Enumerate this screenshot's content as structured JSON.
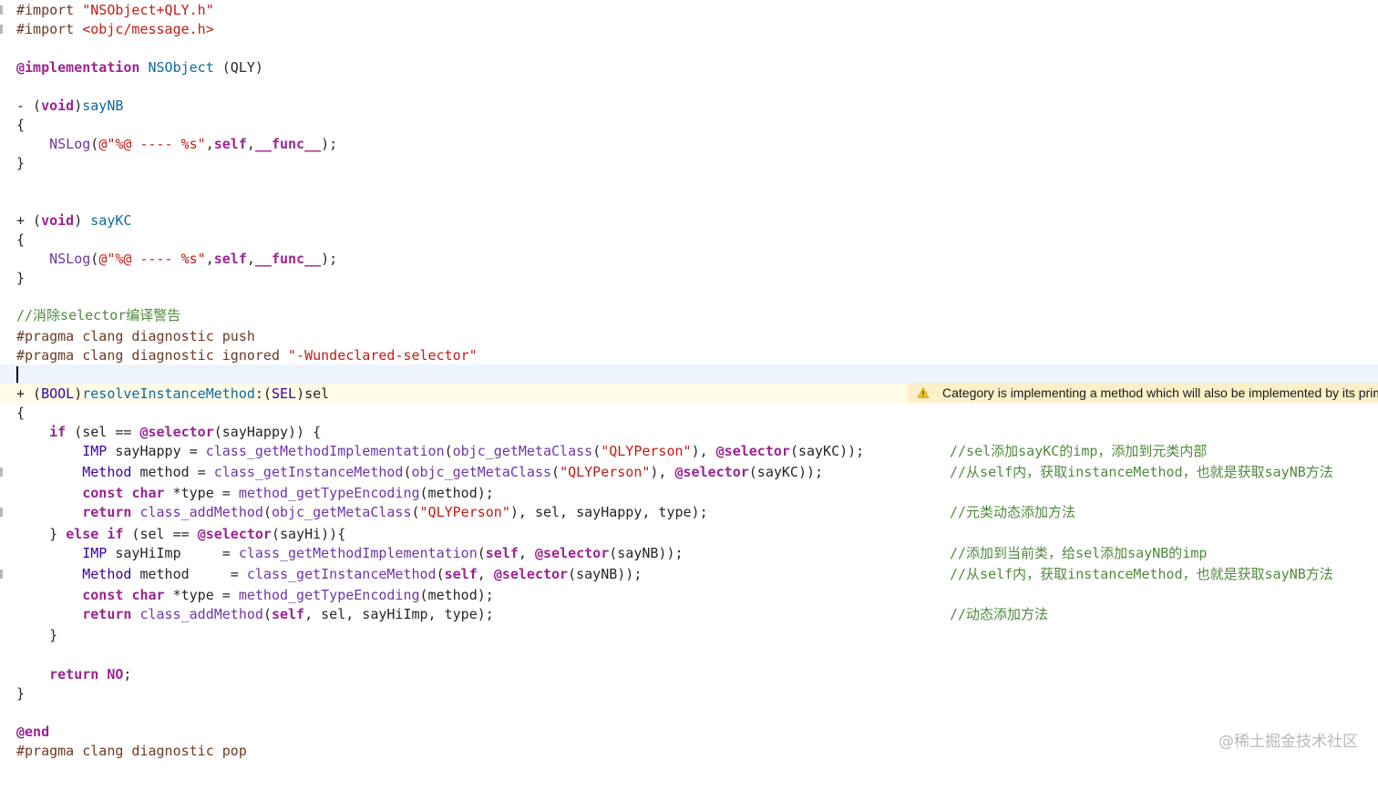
{
  "editor": {
    "lines": {
      "l1": {
        "a": "#import ",
        "b": "\"NSObject+QLY.h\""
      },
      "l2": {
        "a": "#import ",
        "b": "<objc/message.h>"
      },
      "l4": {
        "a": "@implementation",
        "b": " ",
        "c": "NSObject",
        "d": " (QLY)"
      },
      "l6": {
        "a": "- (",
        "b": "void",
        "c": ")",
        "d": "sayNB"
      },
      "l7": {
        "a": "{"
      },
      "l8": {
        "a": "    ",
        "b": "NSLog",
        "c": "(",
        "d": "@\"%@ ---- %s\"",
        "e": ",",
        "f": "self",
        "g": ",",
        "h": "__func__",
        "i": ");"
      },
      "l9": {
        "a": "}"
      },
      "l12": {
        "a": "+ (",
        "b": "void",
        "c": ") ",
        "d": "sayKC"
      },
      "l13": {
        "a": "{"
      },
      "l14": {
        "a": "    ",
        "b": "NSLog",
        "c": "(",
        "d": "@\"%@ ---- %s\"",
        "e": ",",
        "f": "self",
        "g": ",",
        "h": "__func__",
        "i": ");"
      },
      "l15": {
        "a": "}"
      },
      "l17": {
        "a": "//消除selector编译警告"
      },
      "l18": {
        "a": "#pragma clang diagnostic push"
      },
      "l19": {
        "a": "#pragma clang diagnostic ignored ",
        "b": "\"-Wundeclared-selector\""
      },
      "l21": {
        "a": "+ (",
        "b": "BOOL",
        "c": ")",
        "d": "resolveInstanceMethod",
        "e": ":(",
        "f": "SEL",
        "g": ")sel"
      },
      "l22": {
        "a": "{"
      },
      "l23": {
        "a": "    ",
        "b": "if",
        "c": " (sel == ",
        "d": "@selector",
        "e": "(sayHappy)) {"
      },
      "l24": {
        "a": "        ",
        "b": "IMP",
        "c": " sayHappy = ",
        "d": "class_getMethodImplementation",
        "e": "(",
        "f": "objc_getMetaClass",
        "g": "(",
        "h": "\"QLYPerson\"",
        "i": "), ",
        "j": "@selector",
        "k": "(sayKC));",
        "comment": "//sel添加sayKC的imp，添加到元类内部"
      },
      "l25": {
        "a": "        ",
        "b": "Method",
        "c": " method = ",
        "d": "class_getInstanceMethod",
        "e": "(",
        "f": "objc_getMetaClass",
        "g": "(",
        "h": "\"QLYPerson\"",
        "i": "), ",
        "j": "@selector",
        "k": "(sayKC));",
        "comment": "//从self内，获取instanceMethod，也就是获取sayNB方法"
      },
      "l26": {
        "a": "        ",
        "b": "const",
        "c": " ",
        "d": "char",
        "e": " *type = ",
        "f": "method_getTypeEncoding",
        "g": "(method);"
      },
      "l27": {
        "a": "        ",
        "b": "return",
        "c": " ",
        "d": "class_addMethod",
        "e": "(",
        "f": "objc_getMetaClass",
        "g": "(",
        "h": "\"QLYPerson\"",
        "i": "), sel, sayHappy, type);",
        "comment": "//元类动态添加方法"
      },
      "l28": {
        "a": "    } ",
        "b": "else",
        "c": " ",
        "d": "if",
        "e": " (sel == ",
        "f": "@selector",
        "g": "(sayHi)){"
      },
      "l29": {
        "a": "        ",
        "b": "IMP",
        "c": " sayHiImp     = ",
        "d": "class_getMethodImplementation",
        "e": "(",
        "f": "self",
        "g": ", ",
        "h": "@selector",
        "i": "(sayNB));",
        "comment": "//添加到当前类，给sel添加sayNB的imp"
      },
      "l30": {
        "a": "        ",
        "b": "Method",
        "c": " method     = ",
        "d": "class_getInstanceMethod",
        "e": "(",
        "f": "self",
        "g": ", ",
        "h": "@selector",
        "i": "(sayNB));",
        "comment": "//从self内，获取instanceMethod，也就是获取sayNB方法"
      },
      "l31": {
        "a": "        ",
        "b": "const",
        "c": " ",
        "d": "char",
        "e": " *type = ",
        "f": "method_getTypeEncoding",
        "g": "(method);"
      },
      "l32": {
        "a": "        ",
        "b": "return",
        "c": " ",
        "d": "class_addMethod",
        "e": "(",
        "f": "self",
        "g": ", sel, sayHiImp, type);",
        "comment": "//动态添加方法"
      },
      "l33": {
        "a": "    }"
      },
      "l35": {
        "a": "    ",
        "b": "return",
        "c": " ",
        "d": "NO",
        "e": ";"
      },
      "l36": {
        "a": "}"
      },
      "l38": {
        "a": "@end"
      },
      "l39": {
        "a": "#pragma clang diagnostic pop"
      }
    }
  },
  "warning": {
    "icon": "warning-triangle-icon",
    "text": "Category is implementing a method which will also be implemented by its primary class"
  },
  "watermark": "@稀土掘金技术社区",
  "colors": {
    "keyword": "#9b2393",
    "string": "#c41a16",
    "comment": "#4f8a3c",
    "declaration": "#0f68a0",
    "type": "#3900a0",
    "function": "#6c36a9",
    "preprocessor": "#6c3a25",
    "warning_background": "#fbf0c8",
    "current_line": "#eef4fc"
  }
}
